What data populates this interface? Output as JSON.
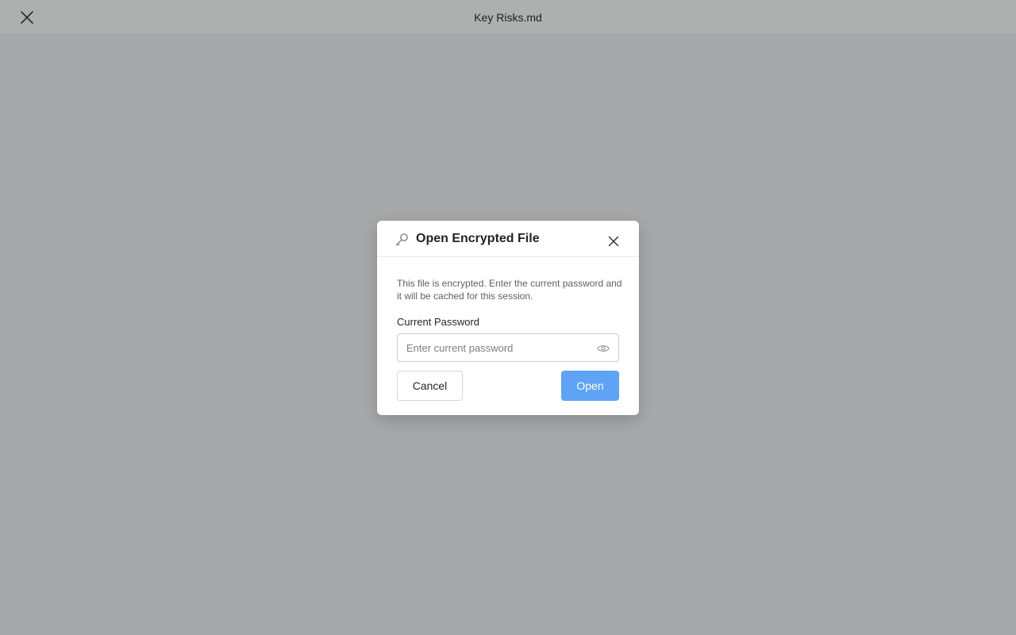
{
  "window": {
    "title": "Key Risks.md",
    "close_icon": "close-icon"
  },
  "dialog": {
    "title": "Open Encrypted File",
    "title_icon": "key-icon",
    "close_icon": "close-icon",
    "description": "This file is encrypted. Enter the current password and it will be cached for this session.",
    "password_label": "Current Password",
    "password_value": "",
    "password_placeholder": "Enter current password",
    "reveal_icon": "eye-icon",
    "cancel_label": "Cancel",
    "open_label": "Open"
  },
  "colors": {
    "overlay": "#a7a8a9",
    "primary_button": "#5ea3f5",
    "text": "#1f2328",
    "muted_text": "#5d6167"
  }
}
